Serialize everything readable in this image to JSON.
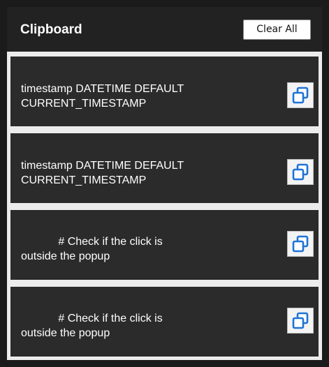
{
  "header": {
    "title": "Clipboard",
    "clear_label": "Clear All"
  },
  "items": [
    {
      "text": "timestamp DATETIME DEFAULT\nCURRENT_TIMESTAMP",
      "icon": "copy-icon"
    },
    {
      "text": "timestamp DATETIME DEFAULT\nCURRENT_TIMESTAMP",
      "icon": "copy-icon"
    },
    {
      "text": "            # Check if the click is\noutside the popup",
      "icon": "copy-icon"
    },
    {
      "text": "            # Check if the click is\noutside the popup",
      "icon": "copy-icon"
    }
  ],
  "colors": {
    "background": "#1b1b1b",
    "header": "#222222",
    "item": "#2b2b2b",
    "separator": "#ececec",
    "accent": "#1e73d6"
  }
}
